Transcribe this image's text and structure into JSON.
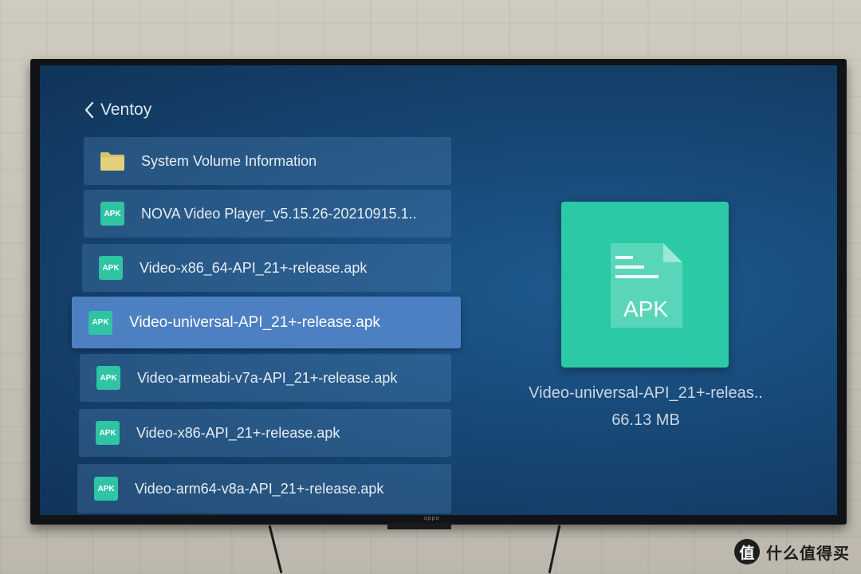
{
  "nav": {
    "back_label": "Ventoy"
  },
  "files": [
    {
      "name": "System Volume Information",
      "type": "folder"
    },
    {
      "name": "NOVA Video Player_v5.15.26-20210915.1..",
      "type": "apk",
      "badge": "APK"
    },
    {
      "name": "Video-x86_64-API_21+-release.apk",
      "type": "apk",
      "badge": "APK"
    },
    {
      "name": "Video-universal-API_21+-release.apk",
      "type": "apk",
      "badge": "APK",
      "selected": true
    },
    {
      "name": "Video-armeabi-v7a-API_21+-release.apk",
      "type": "apk",
      "badge": "APK"
    },
    {
      "name": "Video-x86-API_21+-release.apk",
      "type": "apk",
      "badge": "APK"
    },
    {
      "name": "Video-arm64-v8a-API_21+-release.apk",
      "type": "apk",
      "badge": "APK"
    }
  ],
  "preview": {
    "icon_label": "APK",
    "file_name": "Video-universal-API_21+-releas..",
    "file_size": "66.13 MB"
  },
  "tv": {
    "brand": "oppo"
  },
  "watermark": {
    "symbol": "值",
    "text": "什么值得买"
  },
  "colors": {
    "apk_green": "#2bc9a6",
    "selected_row": "#4d80c2",
    "row": "#3a6796",
    "folder_yellow": "#d8c46a"
  },
  "icons": {
    "back": "chevron-left-icon",
    "folder": "folder-icon",
    "apk": "apk-file-icon",
    "preview": "apk-document-icon"
  }
}
